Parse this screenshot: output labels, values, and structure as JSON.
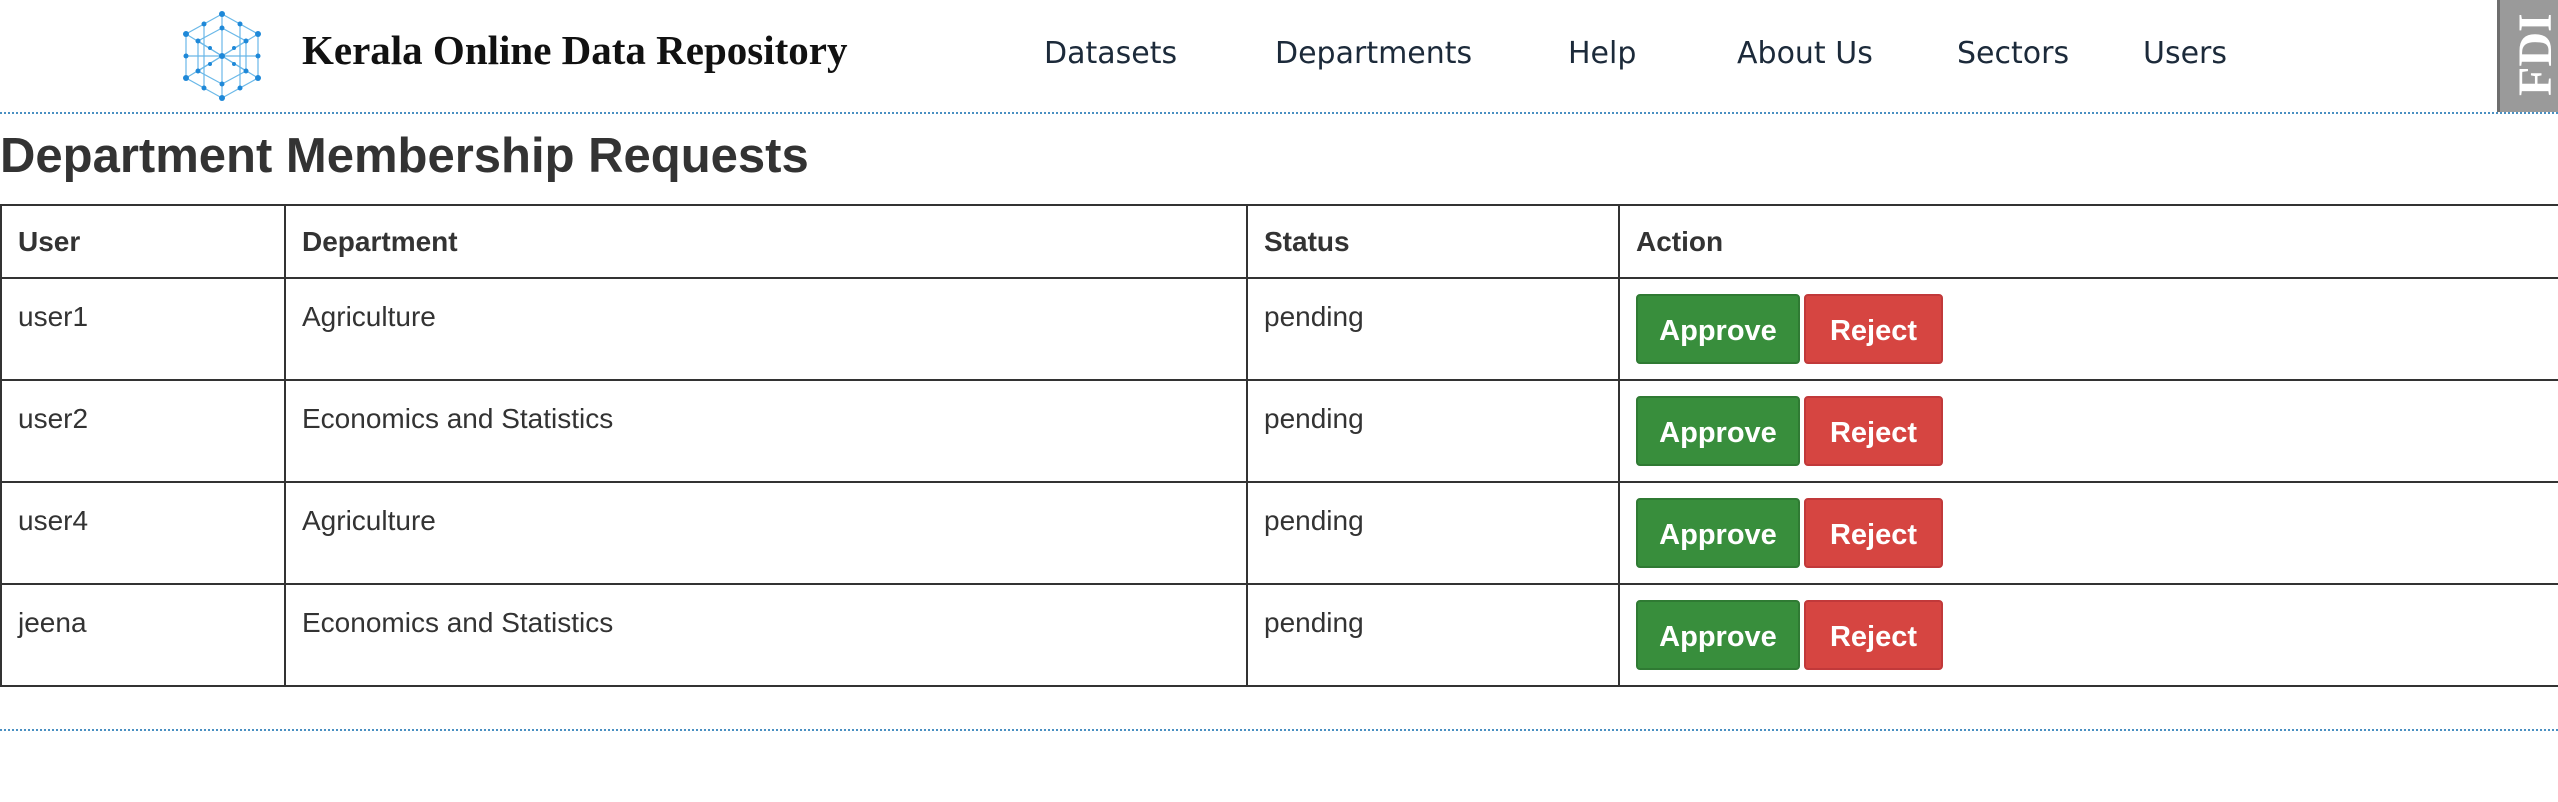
{
  "header": {
    "site_title": "Kerala Online Data Repository",
    "logo_icon": "network-globe-icon",
    "nav": {
      "datasets": "Datasets",
      "departments": "Departments",
      "help": "Help",
      "about": "About Us",
      "sectors": "Sectors",
      "users": "Users"
    },
    "side_widget_text": "FDI"
  },
  "page_title": "Department Membership Requests",
  "table": {
    "headers": {
      "user": "User",
      "department": "Department",
      "status": "Status",
      "action": "Action"
    },
    "rows": [
      {
        "user": "user1",
        "department": "Agriculture",
        "status": "pending",
        "approve": "Approve",
        "reject": "Reject"
      },
      {
        "user": "user2",
        "department": "Economics and Statistics",
        "status": "pending",
        "approve": "Approve",
        "reject": "Reject"
      },
      {
        "user": "user4",
        "department": "Agriculture",
        "status": "pending",
        "approve": "Approve",
        "reject": "Reject"
      },
      {
        "user": "jeena",
        "department": "Economics and Statistics",
        "status": "pending",
        "approve": "Approve",
        "reject": "Reject"
      }
    ]
  },
  "colors": {
    "approve": "#388e3c",
    "reject": "#d64541",
    "divider": "#4a90c2"
  }
}
